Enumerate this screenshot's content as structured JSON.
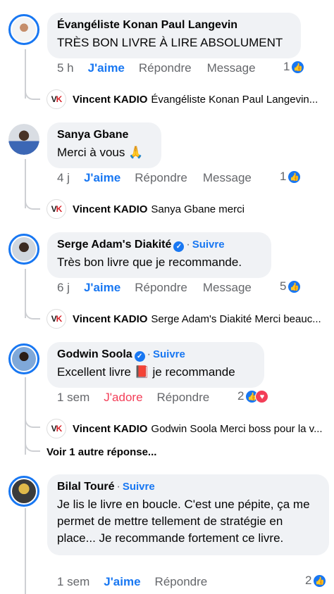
{
  "comments": [
    {
      "author": "Évangéliste Konan Paul Langevin",
      "text": "TRÈS BON LIVRE À LIRE ABSOLUMENT",
      "time": "5 h",
      "like": "J'aime",
      "reply": "Répondre",
      "message": "Message",
      "count": "1",
      "reply_preview": {
        "author": "Vincent KADIO",
        "text": "Évangéliste Konan Paul Langevin..."
      }
    },
    {
      "author": "Sanya Gbane",
      "text": "Merci à vous 🙏",
      "time": "4 j",
      "like": "J'aime",
      "reply": "Répondre",
      "message": "Message",
      "count": "1",
      "reply_preview": {
        "author": "Vincent KADIO",
        "text": "Sanya Gbane merci"
      }
    },
    {
      "author": "Serge Adam's Diakité",
      "follow": "Suivre",
      "text": "Très bon livre que je recommande.",
      "time": "6 j",
      "like": "J'aime",
      "reply": "Répondre",
      "message": "Message",
      "count": "5",
      "reply_preview": {
        "author": "Vincent KADIO",
        "text": "Serge Adam's Diakité Merci beauc..."
      }
    },
    {
      "author": "Godwin Soola",
      "follow": "Suivre",
      "text": "Excellent livre 📕 je recommande",
      "time": "1 sem",
      "like": "J'adore",
      "reply": "Répondre",
      "count": "2",
      "reply_preview": {
        "author": "Vincent KADIO",
        "text": "Godwin Soola Merci boss pour la v..."
      },
      "more_replies": "Voir 1 autre réponse..."
    },
    {
      "author": "Bilal Touré",
      "follow": "Suivre",
      "text": "Je lis le livre en boucle. C'est une pépite, ça me permet de mettre tellement de stratégie en place... Je recommande fortement ce livre.",
      "time": "1 sem",
      "like": "J'aime",
      "reply": "Répondre",
      "count": "2"
    }
  ],
  "logo_text": "VK",
  "colors": {
    "accent": "#1877f2",
    "bubble": "#f0f2f5",
    "muted": "#65676b",
    "love": "#f33e58"
  }
}
